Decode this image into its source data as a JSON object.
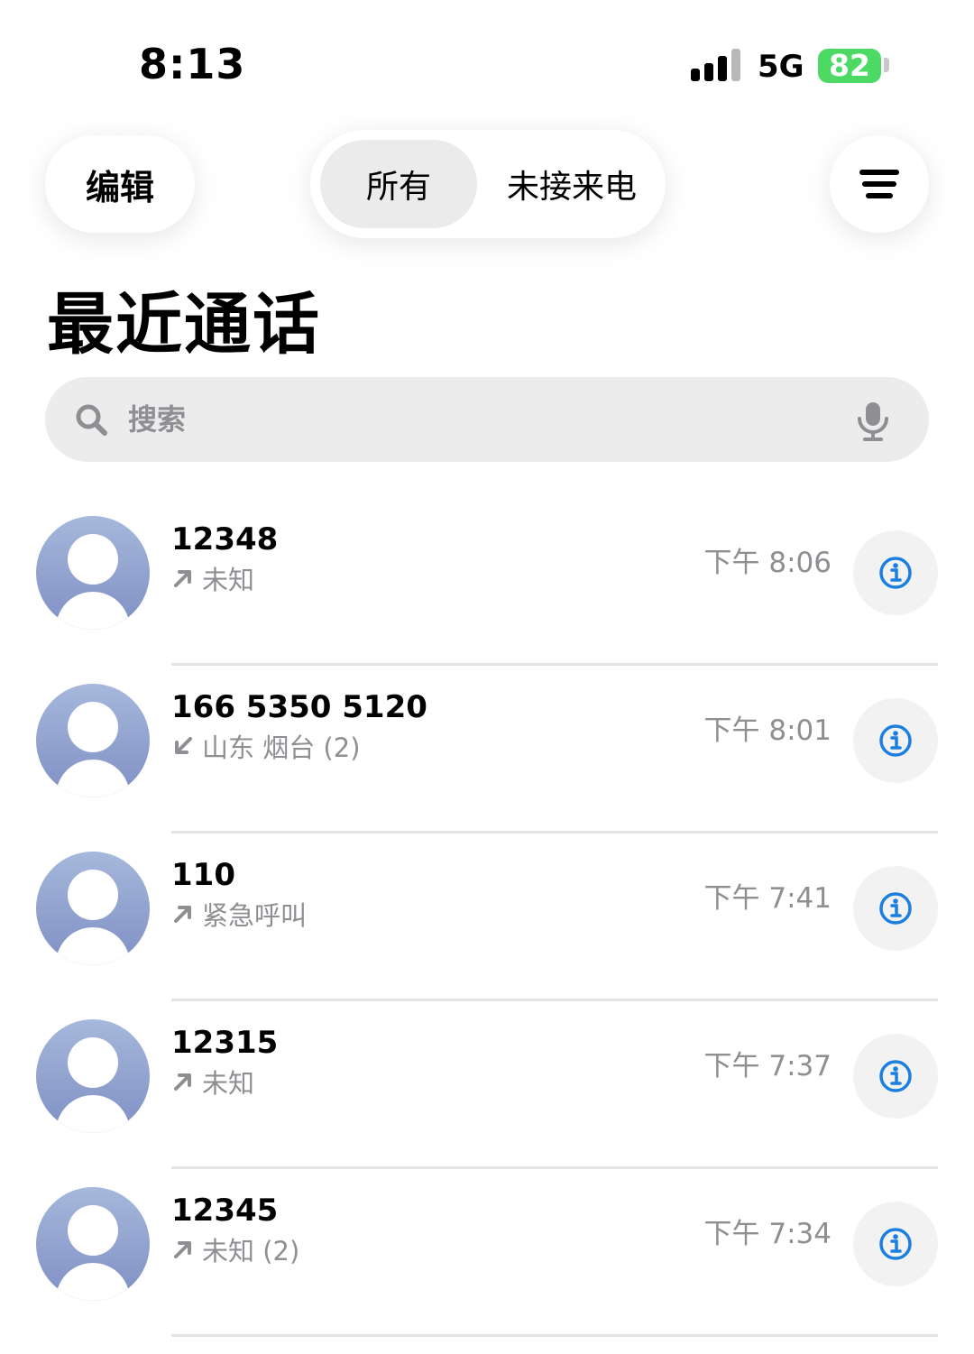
{
  "status": {
    "time": "8:13",
    "network": "5G",
    "battery": "82",
    "signal_bars_active": 3,
    "battery_color": "#4cd964"
  },
  "header": {
    "edit_label": "编辑",
    "segments": [
      {
        "label": "所有",
        "selected": true
      },
      {
        "label": "未接来电",
        "selected": false
      }
    ],
    "filter_icon": "filter-lines-icon"
  },
  "title": "最近通话",
  "search": {
    "placeholder": "搜索",
    "icon": "search-icon",
    "mic_icon": "microphone-icon"
  },
  "calls": [
    {
      "name": "12348",
      "direction": "outgoing",
      "detail": "未知",
      "time": "下午 8:06"
    },
    {
      "name": "166 5350 5120",
      "direction": "incoming",
      "detail": "山东 烟台 (2)",
      "time": "下午 8:01"
    },
    {
      "name": "110",
      "direction": "outgoing",
      "detail": "紧急呼叫",
      "time": "下午 7:41"
    },
    {
      "name": "12315",
      "direction": "outgoing",
      "detail": "未知",
      "time": "下午 7:37"
    },
    {
      "name": "12345",
      "direction": "outgoing",
      "detail": "未知 (2)",
      "time": "下午 7:34"
    }
  ],
  "accent_color": "#1a7fe0"
}
